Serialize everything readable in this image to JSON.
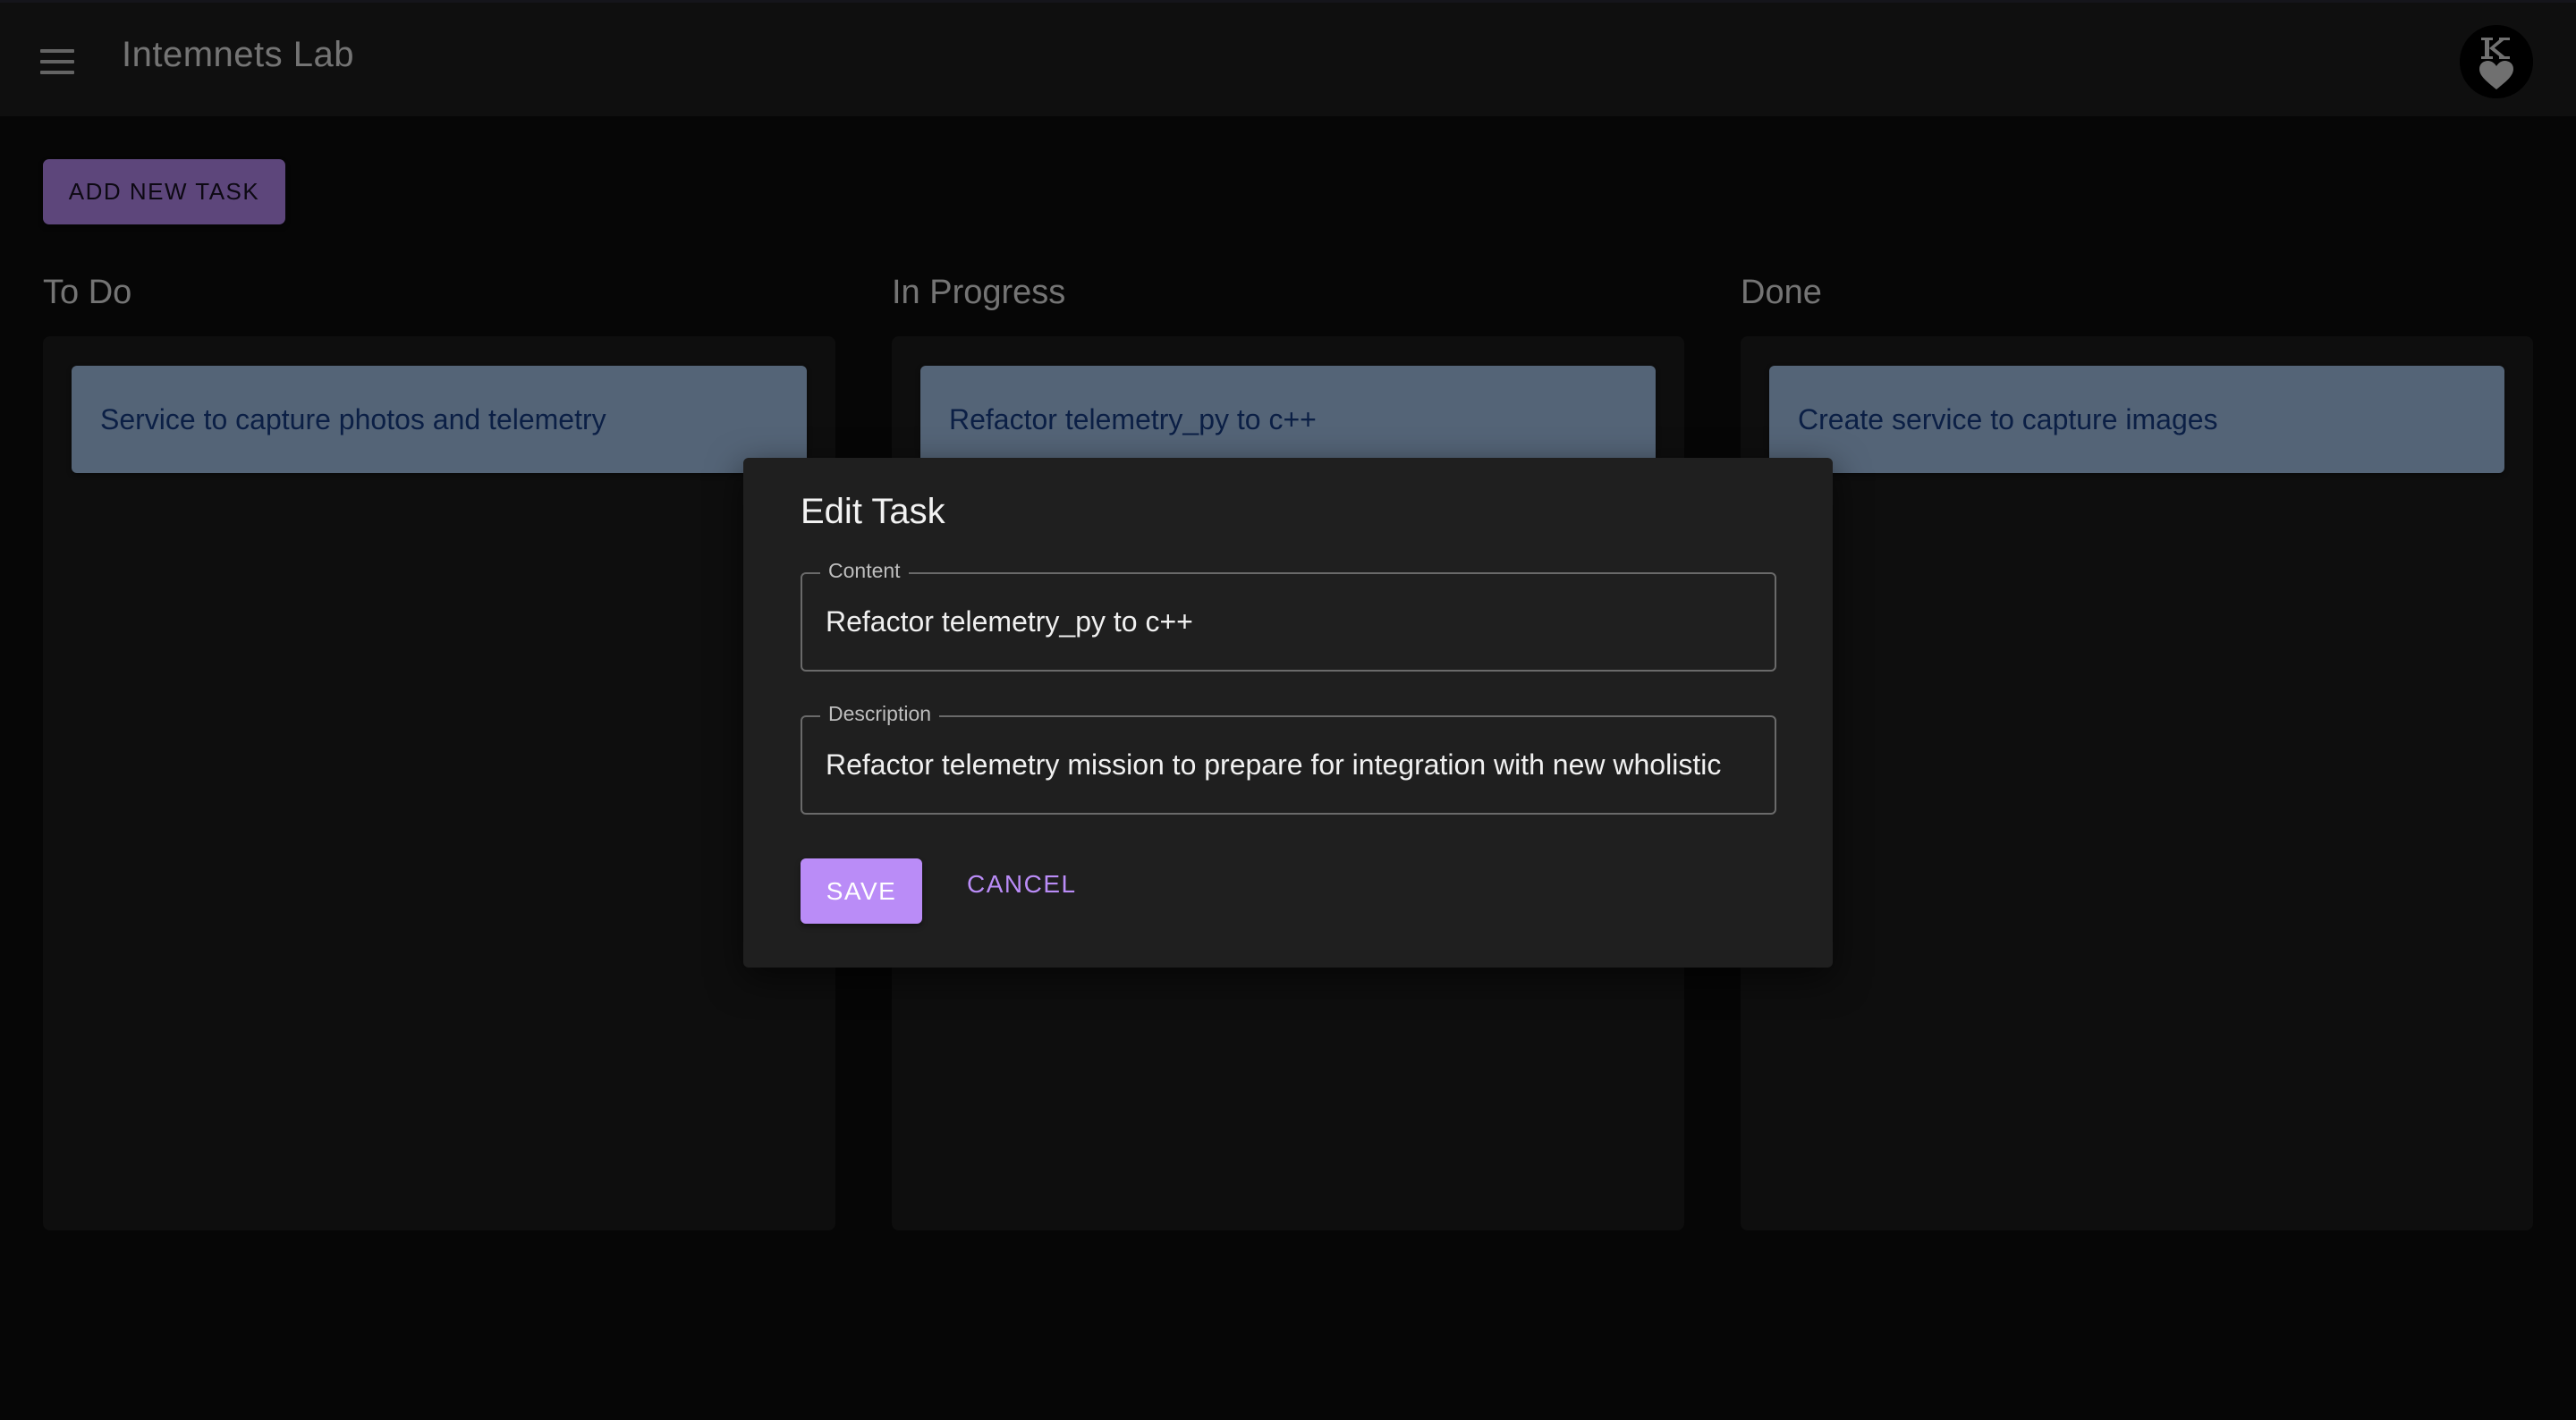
{
  "app": {
    "title": "Intemnets Lab",
    "menu_icon": "hamburger-menu-icon",
    "avatar_icon": "king-of-hearts-avatar-icon"
  },
  "toolbar": {
    "add_task_label": "ADD NEW TASK"
  },
  "columns": [
    {
      "title": "To Do",
      "tasks": [
        "Service to capture photos and telemetry"
      ]
    },
    {
      "title": "In Progress",
      "tasks": [
        "Refactor telemetry_py to c++"
      ]
    },
    {
      "title": "Done",
      "tasks": [
        "Create service to capture images"
      ]
    }
  ],
  "dialog": {
    "title": "Edit Task",
    "content_label": "Content",
    "content_value": "Refactor telemetry_py to c++",
    "description_label": "Description",
    "description_value": "Refactor telemetry mission to prepare for integration with new wholistic",
    "save_label": "SAVE",
    "cancel_label": "CANCEL"
  },
  "colors": {
    "accent": "#ba8cf7",
    "card": "#a9c9ef",
    "card_text": "#173e8a",
    "appbar": "#1e1e1e",
    "background": "#0c0c0c"
  }
}
